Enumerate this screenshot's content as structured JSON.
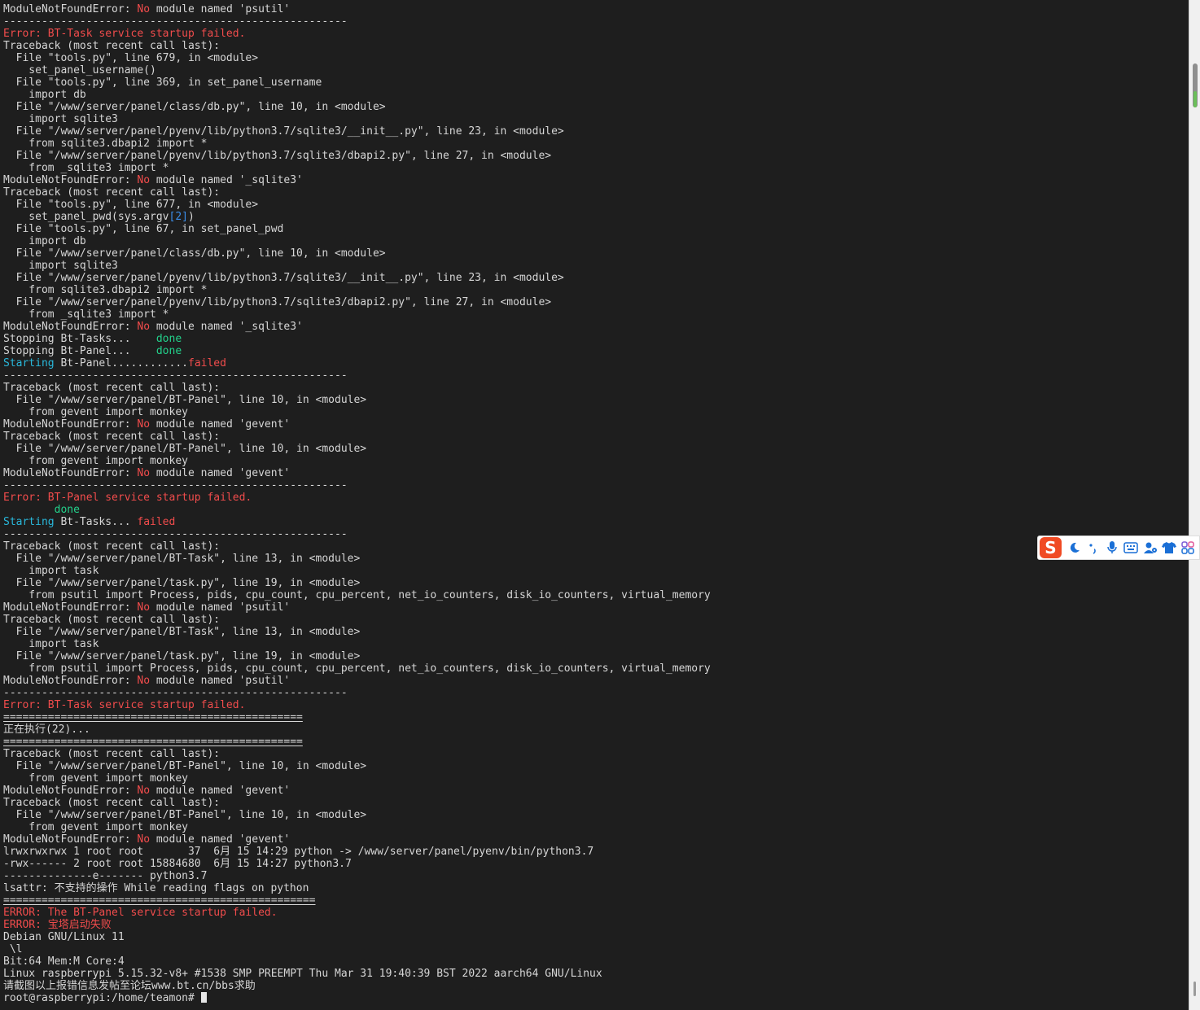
{
  "terminal": {
    "lines": [
      [
        {
          "t": "ModuleNotFoundError: "
        },
        {
          "t": "No",
          "c": "red"
        },
        {
          "t": " module named 'psutil'"
        }
      ],
      [
        {
          "t": "------------------------------------------------------"
        }
      ],
      [
        {
          "t": "Error: BT-Task service startup failed.",
          "c": "red"
        }
      ],
      [
        {
          "t": "Traceback (most recent call last):"
        }
      ],
      [
        {
          "t": "  File \"tools.py\", line 679, in <module>"
        }
      ],
      [
        {
          "t": "    set_panel_username()"
        }
      ],
      [
        {
          "t": "  File \"tools.py\", line 369, in set_panel_username"
        }
      ],
      [
        {
          "t": "    import db"
        }
      ],
      [
        {
          "t": "  File \"/www/server/panel/class/db.py\", line 10, in <module>"
        }
      ],
      [
        {
          "t": "    import sqlite3"
        }
      ],
      [
        {
          "t": "  File \"/www/server/panel/pyenv/lib/python3.7/sqlite3/__init__.py\", line 23, in <module>"
        }
      ],
      [
        {
          "t": "    from sqlite3.dbapi2 import *"
        }
      ],
      [
        {
          "t": "  File \"/www/server/panel/pyenv/lib/python3.7/sqlite3/dbapi2.py\", line 27, in <module>"
        }
      ],
      [
        {
          "t": "    from _sqlite3 import *"
        }
      ],
      [
        {
          "t": "ModuleNotFoundError: "
        },
        {
          "t": "No",
          "c": "red"
        },
        {
          "t": " module named '_sqlite3'"
        }
      ],
      [
        {
          "t": "Traceback (most recent call last):"
        }
      ],
      [
        {
          "t": "  File \"tools.py\", line 677, in <module>"
        }
      ],
      [
        {
          "t": "    set_panel_pwd(sys.argv"
        },
        {
          "t": "[2]",
          "c": "blue"
        },
        {
          "t": ")"
        }
      ],
      [
        {
          "t": "  File \"tools.py\", line 67, in set_panel_pwd"
        }
      ],
      [
        {
          "t": "    import db"
        }
      ],
      [
        {
          "t": "  File \"/www/server/panel/class/db.py\", line 10, in <module>"
        }
      ],
      [
        {
          "t": "    import sqlite3"
        }
      ],
      [
        {
          "t": "  File \"/www/server/panel/pyenv/lib/python3.7/sqlite3/__init__.py\", line 23, in <module>"
        }
      ],
      [
        {
          "t": "    from sqlite3.dbapi2 import *"
        }
      ],
      [
        {
          "t": "  File \"/www/server/panel/pyenv/lib/python3.7/sqlite3/dbapi2.py\", line 27, in <module>"
        }
      ],
      [
        {
          "t": "    from _sqlite3 import *"
        }
      ],
      [
        {
          "t": "ModuleNotFoundError: "
        },
        {
          "t": "No",
          "c": "red"
        },
        {
          "t": " module named '_sqlite3'"
        }
      ],
      [
        {
          "t": "Stopping Bt-Tasks...    "
        },
        {
          "t": "done",
          "c": "green"
        }
      ],
      [
        {
          "t": "Stopping Bt-Panel...    "
        },
        {
          "t": "done",
          "c": "green"
        }
      ],
      [
        {
          "t": "Starting",
          "c": "cyan"
        },
        {
          "t": " Bt-Panel............"
        },
        {
          "t": "failed",
          "c": "red"
        }
      ],
      [
        {
          "t": "------------------------------------------------------"
        }
      ],
      [
        {
          "t": "Traceback (most recent call last):"
        }
      ],
      [
        {
          "t": "  File \"/www/server/panel/BT-Panel\", line 10, in <module>"
        }
      ],
      [
        {
          "t": "    from gevent import monkey"
        }
      ],
      [
        {
          "t": "ModuleNotFoundError: "
        },
        {
          "t": "No",
          "c": "red"
        },
        {
          "t": " module named 'gevent'"
        }
      ],
      [
        {
          "t": "Traceback (most recent call last):"
        }
      ],
      [
        {
          "t": "  File \"/www/server/panel/BT-Panel\", line 10, in <module>"
        }
      ],
      [
        {
          "t": "    from gevent import monkey"
        }
      ],
      [
        {
          "t": "ModuleNotFoundError: "
        },
        {
          "t": "No",
          "c": "red"
        },
        {
          "t": " module named 'gevent'"
        }
      ],
      [
        {
          "t": "------------------------------------------------------"
        }
      ],
      [
        {
          "t": "Error: BT-Panel service startup failed.",
          "c": "red"
        }
      ],
      [
        {
          "t": "        "
        },
        {
          "t": "done",
          "c": "green"
        }
      ],
      [
        {
          "t": "Starting",
          "c": "cyan"
        },
        {
          "t": " Bt-Tasks... "
        },
        {
          "t": "failed",
          "c": "red"
        }
      ],
      [
        {
          "t": "------------------------------------------------------"
        }
      ],
      [
        {
          "t": "Traceback (most recent call last):"
        }
      ],
      [
        {
          "t": "  File \"/www/server/panel/BT-Task\", line 13, in <module>"
        }
      ],
      [
        {
          "t": "    import task"
        }
      ],
      [
        {
          "t": "  File \"/www/server/panel/task.py\", line 19, in <module>"
        }
      ],
      [
        {
          "t": "    from psutil import Process, pids, cpu_count, cpu_percent, net_io_counters, disk_io_counters, virtual_memory"
        }
      ],
      [
        {
          "t": "ModuleNotFoundError: "
        },
        {
          "t": "No",
          "c": "red"
        },
        {
          "t": " module named 'psutil'"
        }
      ],
      [
        {
          "t": "Traceback (most recent call last):"
        }
      ],
      [
        {
          "t": "  File \"/www/server/panel/BT-Task\", line 13, in <module>"
        }
      ],
      [
        {
          "t": "    import task"
        }
      ],
      [
        {
          "t": "  File \"/www/server/panel/task.py\", line 19, in <module>"
        }
      ],
      [
        {
          "t": "    from psutil import Process, pids, cpu_count, cpu_percent, net_io_counters, disk_io_counters, virtual_memory"
        }
      ],
      [
        {
          "t": "ModuleNotFoundError: "
        },
        {
          "t": "No",
          "c": "red"
        },
        {
          "t": " module named 'psutil'"
        }
      ],
      [
        {
          "t": "------------------------------------------------------"
        }
      ],
      [
        {
          "t": "Error: BT-Task service startup failed.",
          "c": "red"
        }
      ],
      [
        {
          "t": "===============================================",
          "u": true
        }
      ],
      [
        {
          "t": "正在执行(22)..."
        }
      ],
      [
        {
          "t": "===============================================",
          "u": true
        }
      ],
      [
        {
          "t": "Traceback (most recent call last):"
        }
      ],
      [
        {
          "t": "  File \"/www/server/panel/BT-Panel\", line 10, in <module>"
        }
      ],
      [
        {
          "t": "    from gevent import monkey"
        }
      ],
      [
        {
          "t": "ModuleNotFoundError: "
        },
        {
          "t": "No",
          "c": "red"
        },
        {
          "t": " module named 'gevent'"
        }
      ],
      [
        {
          "t": "Traceback (most recent call last):"
        }
      ],
      [
        {
          "t": "  File \"/www/server/panel/BT-Panel\", line 10, in <module>"
        }
      ],
      [
        {
          "t": "    from gevent import monkey"
        }
      ],
      [
        {
          "t": "ModuleNotFoundError: "
        },
        {
          "t": "No",
          "c": "red"
        },
        {
          "t": " module named 'gevent'"
        }
      ],
      [
        {
          "t": "lrwxrwxrwx 1 root root       37  6月 15 14:29 python -> /www/server/panel/pyenv/bin/python3.7"
        }
      ],
      [
        {
          "t": "-rwx------ 2 root root 15884680  6月 15 14:27 python3.7"
        }
      ],
      [
        {
          "t": "--------------e------- python3.7"
        }
      ],
      [
        {
          "t": "lsattr: 不支持的操作 While reading flags on python"
        }
      ],
      [
        {
          "t": "=================================================",
          "u": true
        }
      ],
      [
        {
          "t": "ERROR: The BT-Panel service startup failed.",
          "c": "red"
        }
      ],
      [
        {
          "t": "ERROR: 宝塔启动失败",
          "c": "red"
        }
      ],
      [
        {
          "t": "Debian GNU/Linux 11"
        }
      ],
      [
        {
          "t": " \\l"
        }
      ],
      [
        {
          "t": "Bit:64 Mem:M Core:4"
        }
      ],
      [
        {
          "t": "Linux raspberrypi 5.15.32-v8+ #1538 SMP PREEMPT Thu Mar 31 19:40:39 BST 2022 aarch64 GNU/Linux"
        }
      ],
      [
        {
          "t": "请截图以上报错信息发帖至论坛www.bt.cn/bbs求助"
        }
      ],
      [
        {
          "t": "root@raspberrypi:/home/teamon# "
        },
        {
          "cursor": true
        }
      ]
    ]
  },
  "ime_toolbar": {
    "logo_letter": "S",
    "icons": [
      "moon-icon",
      "punctuation-icon",
      "microphone-icon",
      "keyboard-icon",
      "user-settings-icon",
      "skin-shirt-icon",
      "toolbox-grid-icon"
    ],
    "colors": {
      "logo": "#f04a23",
      "icon": "#1a6fd6"
    }
  },
  "colors": {
    "background": "#1e1e1e",
    "text": "#d6d6d6",
    "error_red": "#f14c4c",
    "done_green": "#23d18b",
    "starting_cyan": "#29b8db"
  }
}
